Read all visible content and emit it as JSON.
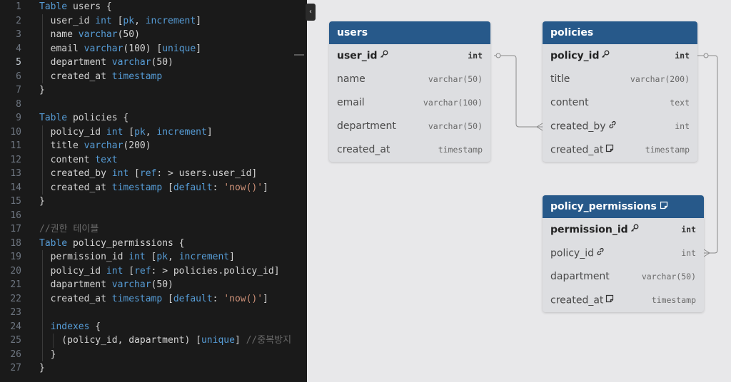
{
  "editor": {
    "active_line": 5,
    "lines": [
      [
        [
          "kw",
          "Table"
        ],
        [
          "plain",
          " users {"
        ]
      ],
      [
        [
          "plain",
          "  user_id "
        ],
        [
          "type",
          "int"
        ],
        [
          "plain",
          " ["
        ],
        [
          "attr",
          "pk"
        ],
        [
          "plain",
          ", "
        ],
        [
          "attr",
          "increment"
        ],
        [
          "plain",
          "]"
        ]
      ],
      [
        [
          "plain",
          "  name "
        ],
        [
          "type",
          "varchar"
        ],
        [
          "plain",
          "(50)"
        ]
      ],
      [
        [
          "plain",
          "  email "
        ],
        [
          "type",
          "varchar"
        ],
        [
          "plain",
          "(100) ["
        ],
        [
          "attr",
          "unique"
        ],
        [
          "plain",
          "]"
        ]
      ],
      [
        [
          "plain",
          "  department "
        ],
        [
          "type",
          "varchar"
        ],
        [
          "plain",
          "(50)"
        ]
      ],
      [
        [
          "plain",
          "  created_at "
        ],
        [
          "type",
          "timestamp"
        ]
      ],
      [
        [
          "plain",
          "}"
        ]
      ],
      [],
      [
        [
          "kw",
          "Table"
        ],
        [
          "plain",
          " policies {"
        ]
      ],
      [
        [
          "plain",
          "  policy_id "
        ],
        [
          "type",
          "int"
        ],
        [
          "plain",
          " ["
        ],
        [
          "attr",
          "pk"
        ],
        [
          "plain",
          ", "
        ],
        [
          "attr",
          "increment"
        ],
        [
          "plain",
          "]"
        ]
      ],
      [
        [
          "plain",
          "  title "
        ],
        [
          "type",
          "varchar"
        ],
        [
          "plain",
          "(200)"
        ]
      ],
      [
        [
          "plain",
          "  content "
        ],
        [
          "type",
          "text"
        ]
      ],
      [
        [
          "plain",
          "  created_by "
        ],
        [
          "type",
          "int"
        ],
        [
          "plain",
          " ["
        ],
        [
          "attr",
          "ref"
        ],
        [
          "plain",
          ": > users.user_id]"
        ]
      ],
      [
        [
          "plain",
          "  created_at "
        ],
        [
          "type",
          "timestamp"
        ],
        [
          "plain",
          " ["
        ],
        [
          "attr",
          "default"
        ],
        [
          "plain",
          ": "
        ],
        [
          "str",
          "'now()'"
        ],
        [
          "plain",
          "]"
        ]
      ],
      [
        [
          "plain",
          "}"
        ]
      ],
      [],
      [
        [
          "comment",
          "//권한 테이블"
        ]
      ],
      [
        [
          "kw",
          "Table"
        ],
        [
          "plain",
          " policy_permissions {"
        ]
      ],
      [
        [
          "plain",
          "  permission_id "
        ],
        [
          "type",
          "int"
        ],
        [
          "plain",
          " ["
        ],
        [
          "attr",
          "pk"
        ],
        [
          "plain",
          ", "
        ],
        [
          "attr",
          "increment"
        ],
        [
          "plain",
          "]"
        ]
      ],
      [
        [
          "plain",
          "  policy_id "
        ],
        [
          "type",
          "int"
        ],
        [
          "plain",
          " ["
        ],
        [
          "attr",
          "ref"
        ],
        [
          "plain",
          ": > policies.policy_id]"
        ]
      ],
      [
        [
          "plain",
          "  dapartment "
        ],
        [
          "type",
          "varchar"
        ],
        [
          "plain",
          "(50)"
        ]
      ],
      [
        [
          "plain",
          "  created_at "
        ],
        [
          "type",
          "timestamp"
        ],
        [
          "plain",
          " ["
        ],
        [
          "attr",
          "default"
        ],
        [
          "plain",
          ": "
        ],
        [
          "str",
          "'now()'"
        ],
        [
          "plain",
          "]"
        ]
      ],
      [],
      [
        [
          "plain",
          "  "
        ],
        [
          "kw",
          "indexes"
        ],
        [
          "plain",
          " {"
        ]
      ],
      [
        [
          "plain",
          "    (policy_id, dapartment) ["
        ],
        [
          "attr",
          "unique"
        ],
        [
          "plain",
          "] "
        ],
        [
          "comment",
          "//중복방지"
        ]
      ],
      [
        [
          "plain",
          "  }"
        ]
      ],
      [
        [
          "plain",
          "}"
        ]
      ]
    ]
  },
  "collapse_button": {
    "glyph": "‹"
  },
  "tables": {
    "users": {
      "name": "users",
      "fields": [
        {
          "name": "user_id",
          "type": "int",
          "pk": true,
          "icon": "key-icon"
        },
        {
          "name": "name",
          "type": "varchar(50)"
        },
        {
          "name": "email",
          "type": "varchar(100)"
        },
        {
          "name": "department",
          "type": "varchar(50)"
        },
        {
          "name": "created_at",
          "type": "timestamp"
        }
      ]
    },
    "policies": {
      "name": "policies",
      "fields": [
        {
          "name": "policy_id",
          "type": "int",
          "pk": true,
          "icon": "key-icon"
        },
        {
          "name": "title",
          "type": "varchar(200)"
        },
        {
          "name": "content",
          "type": "text"
        },
        {
          "name": "created_by",
          "type": "int",
          "icon": "link-icon"
        },
        {
          "name": "created_at",
          "type": "timestamp",
          "icon": "note-icon"
        }
      ]
    },
    "policy_permissions": {
      "name": "policy_permissions",
      "header_icon": "note-icon",
      "fields": [
        {
          "name": "permission_id",
          "type": "int",
          "pk": true,
          "icon": "key-icon"
        },
        {
          "name": "policy_id",
          "type": "int",
          "icon": "link-icon"
        },
        {
          "name": "dapartment",
          "type": "varchar(50)"
        },
        {
          "name": "created_at",
          "type": "timestamp",
          "icon": "note-icon"
        }
      ]
    }
  },
  "colors": {
    "table_header": "#27598a",
    "canvas_bg": "#e8e8ea",
    "editor_bg": "#1a1a1a",
    "keyword": "#569cd6",
    "string": "#ce9178",
    "relation_line": "#8a8a8a"
  }
}
